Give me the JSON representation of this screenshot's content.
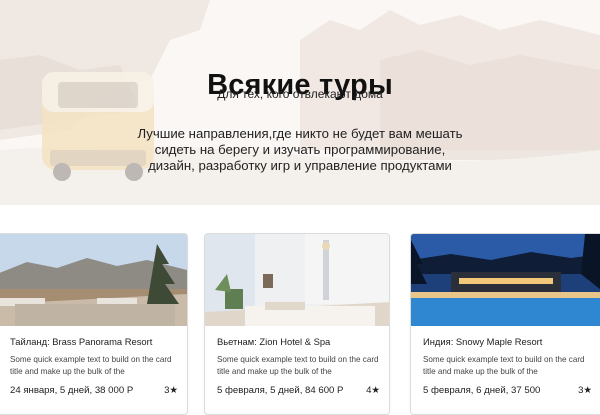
{
  "hero": {
    "title": "Всякие туры",
    "subtitle": "Для тех, кого отвлекают дома",
    "lead": "Лучшие направления,где никто не будет вам мешать сидеть на берегу и изучать программирование, дизайн, разработку игр и управление продуктами"
  },
  "cards": [
    {
      "title": "Тайланд: Brass Panorama Resort",
      "text": "Some quick example text to build on the card title and make up the bulk of the",
      "meta": "24 января, 5 дней, 38 000 Р",
      "rating": "3★"
    },
    {
      "title": "Вьетнам: Zion Hotel & Spa",
      "text": "Some quick example text to build on the card title and make up the bulk of the",
      "meta": "5 февраля, 5 дней, 84 600 Р",
      "rating": "4★"
    },
    {
      "title": "Индия: Snowy Maple Resort",
      "text": "Some quick example text to build on the card title and make up the bulk of the",
      "meta": "5 февраля, 6 дней,  37 500",
      "rating": "3★"
    }
  ]
}
